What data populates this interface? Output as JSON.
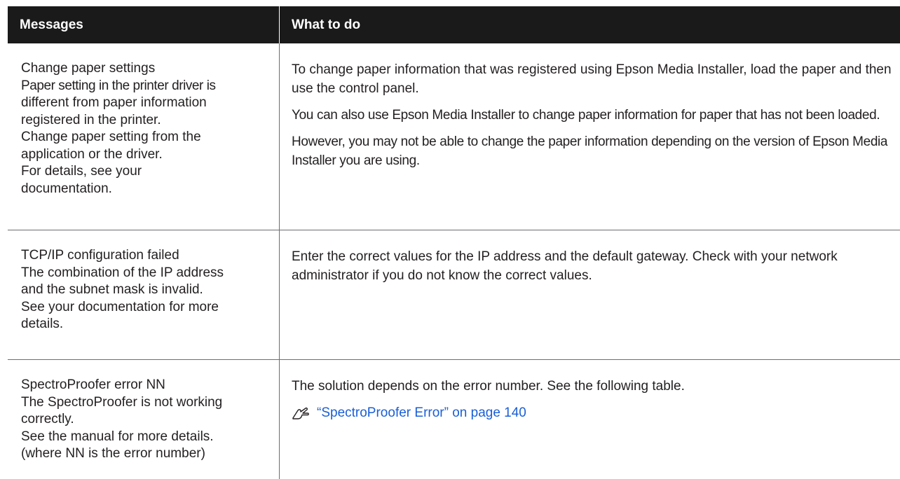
{
  "header": {
    "messages": "Messages",
    "what_to_do": "What to do"
  },
  "rows": [
    {
      "message_lines": [
        "Change paper settings",
        "Paper setting in the printer driver is",
        "different from paper information",
        "registered in the printer.",
        "Change paper setting from the",
        "application or the driver.",
        "For details, see your",
        "documentation."
      ],
      "paragraphs": [
        "To change paper information that was registered using Epson Media Installer, load the paper and then use the control panel.",
        "You can also use Epson Media Installer to change paper information for paper that has not been loaded.",
        "However, you may not be able to change the paper information depending on the version of Epson Media Installer you are using."
      ]
    },
    {
      "message_lines": [
        "TCP/IP configuration failed",
        "The combination of the IP address",
        "and the subnet mask is invalid.",
        "See your documentation for more",
        "details."
      ],
      "paragraphs": [
        "Enter the correct values for the IP address and the default gateway. Check with your network administrator if you do not know the correct values."
      ]
    },
    {
      "message_lines": [
        "SpectroProofer error NN",
        "The SpectroProofer is not working",
        "correctly.",
        "See the manual for more details.",
        "(where NN is the error number)"
      ],
      "paragraphs": [
        "The solution depends on the error number. See the following table."
      ],
      "link": {
        "text": "“SpectroProofer Error” on page 140",
        "icon": "reference-hand-icon"
      }
    }
  ],
  "colors": {
    "header_bg": "#1a1a1a",
    "link": "#1a5fd6"
  }
}
